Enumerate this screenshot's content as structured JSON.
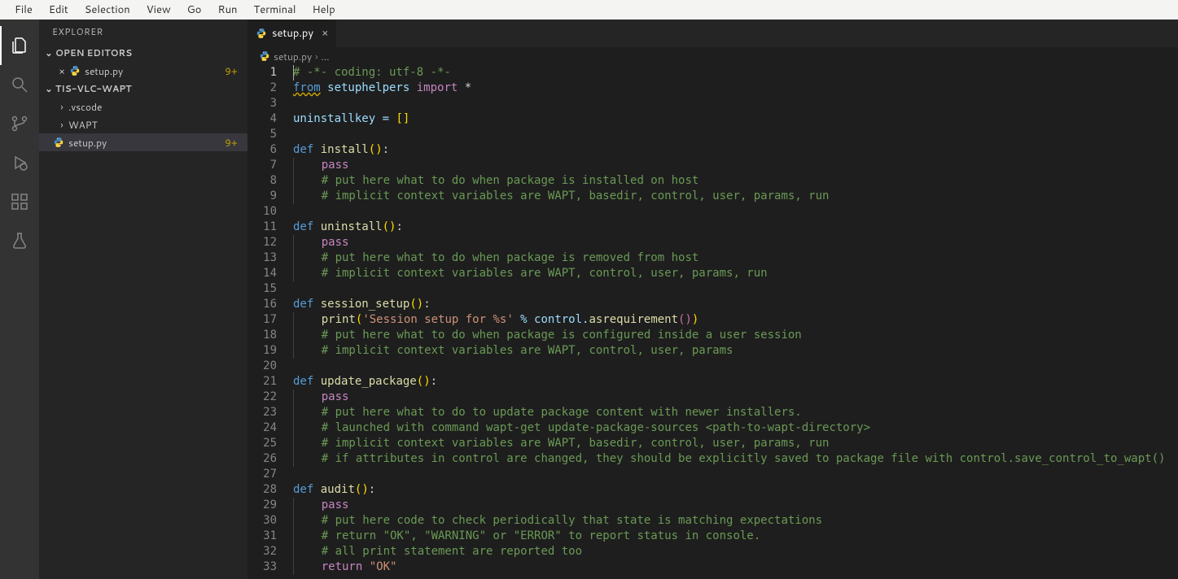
{
  "menubar": [
    "File",
    "Edit",
    "Selection",
    "View",
    "Go",
    "Run",
    "Terminal",
    "Help"
  ],
  "sidebar": {
    "title": "EXPLORER",
    "openEditorsHdr": "OPEN EDITORS",
    "openEditors": [
      {
        "name": "setup.py",
        "badge": "9+"
      }
    ],
    "projectHdr": "TIS-VLC-WAPT",
    "tree": [
      {
        "type": "folder",
        "name": ".vscode"
      },
      {
        "type": "folder",
        "name": "WAPT"
      },
      {
        "type": "file-py",
        "name": "setup.py",
        "badge": "9+"
      }
    ]
  },
  "tabs": [
    {
      "name": "setup.py",
      "lang": "python"
    }
  ],
  "breadcrumb": {
    "file": "setup.py",
    "more": "…"
  },
  "code": {
    "lines": [
      {
        "n": 1,
        "seg": [
          {
            "t": "# -*- coding: utf-8 -*-",
            "c": "comment"
          }
        ],
        "cursor": true
      },
      {
        "n": 2,
        "seg": [
          {
            "t": "from",
            "c": "defsquiggle"
          },
          {
            "t": " setuphelpers ",
            "c": "ident"
          },
          {
            "t": "import",
            "c": "keyword"
          },
          {
            "t": " *",
            "c": "punct"
          }
        ]
      },
      {
        "n": 3,
        "seg": []
      },
      {
        "n": 4,
        "seg": [
          {
            "t": "uninstallkey = ",
            "c": "ident"
          },
          {
            "t": "[",
            "c": "yellow"
          },
          {
            "t": "]",
            "c": "yellow"
          }
        ]
      },
      {
        "n": 5,
        "seg": []
      },
      {
        "n": 6,
        "seg": [
          {
            "t": "def",
            "c": "def"
          },
          {
            "t": " ",
            "c": "punct"
          },
          {
            "t": "install",
            "c": "funcname"
          },
          {
            "t": "(",
            "c": "yellow"
          },
          {
            "t": ")",
            "c": "yellow"
          },
          {
            "t": ":",
            "c": "punct"
          }
        ]
      },
      {
        "n": 7,
        "indent": 1,
        "seg": [
          {
            "t": "pass",
            "c": "keyword"
          }
        ]
      },
      {
        "n": 8,
        "indent": 1,
        "seg": [
          {
            "t": "# put here what to do when package is installed on host",
            "c": "comment"
          }
        ]
      },
      {
        "n": 9,
        "indent": 1,
        "seg": [
          {
            "t": "# implicit context variables are WAPT, basedir, control, user, params, run",
            "c": "comment"
          }
        ]
      },
      {
        "n": 10,
        "seg": []
      },
      {
        "n": 11,
        "seg": [
          {
            "t": "def",
            "c": "def"
          },
          {
            "t": " ",
            "c": "punct"
          },
          {
            "t": "uninstall",
            "c": "funcname"
          },
          {
            "t": "(",
            "c": "yellow"
          },
          {
            "t": ")",
            "c": "yellow"
          },
          {
            "t": ":",
            "c": "punct"
          }
        ]
      },
      {
        "n": 12,
        "indent": 1,
        "seg": [
          {
            "t": "pass",
            "c": "keyword"
          }
        ]
      },
      {
        "n": 13,
        "indent": 1,
        "seg": [
          {
            "t": "# put here what to do when package is removed from host",
            "c": "comment"
          }
        ]
      },
      {
        "n": 14,
        "indent": 1,
        "seg": [
          {
            "t": "# implicit context variables are WAPT, control, user, params, run",
            "c": "comment"
          }
        ]
      },
      {
        "n": 15,
        "seg": []
      },
      {
        "n": 16,
        "seg": [
          {
            "t": "def",
            "c": "def"
          },
          {
            "t": " ",
            "c": "punct"
          },
          {
            "t": "session_setup",
            "c": "funcname"
          },
          {
            "t": "(",
            "c": "yellow"
          },
          {
            "t": ")",
            "c": "yellow"
          },
          {
            "t": ":",
            "c": "punct"
          }
        ]
      },
      {
        "n": 17,
        "indent": 1,
        "seg": [
          {
            "t": "print",
            "c": "funcname"
          },
          {
            "t": "(",
            "c": "yellow"
          },
          {
            "t": "'Session setup for %s'",
            "c": "str"
          },
          {
            "t": " % control.",
            "c": "ident"
          },
          {
            "t": "asrequirement",
            "c": "funcname"
          },
          {
            "t": "(",
            "c": "pink"
          },
          {
            "t": ")",
            "c": "pink"
          },
          {
            "t": ")",
            "c": "yellow"
          }
        ]
      },
      {
        "n": 18,
        "indent": 1,
        "seg": [
          {
            "t": "# put here what to do when package is configured inside a user session",
            "c": "comment"
          }
        ]
      },
      {
        "n": 19,
        "indent": 1,
        "seg": [
          {
            "t": "# implicit context variables are WAPT, control, user, params",
            "c": "comment"
          }
        ]
      },
      {
        "n": 20,
        "seg": []
      },
      {
        "n": 21,
        "seg": [
          {
            "t": "def",
            "c": "def"
          },
          {
            "t": " ",
            "c": "punct"
          },
          {
            "t": "update_package",
            "c": "funcname"
          },
          {
            "t": "(",
            "c": "yellow"
          },
          {
            "t": ")",
            "c": "yellow"
          },
          {
            "t": ":",
            "c": "punct"
          }
        ]
      },
      {
        "n": 22,
        "indent": 1,
        "seg": [
          {
            "t": "pass",
            "c": "keyword"
          }
        ]
      },
      {
        "n": 23,
        "indent": 1,
        "seg": [
          {
            "t": "# put here what to do to update package content with newer installers.",
            "c": "comment"
          }
        ]
      },
      {
        "n": 24,
        "indent": 1,
        "seg": [
          {
            "t": "# launched with command wapt-get update-package-sources <path-to-wapt-directory>",
            "c": "comment"
          }
        ]
      },
      {
        "n": 25,
        "indent": 1,
        "seg": [
          {
            "t": "# implicit context variables are WAPT, basedir, control, user, params, run",
            "c": "comment"
          }
        ]
      },
      {
        "n": 26,
        "indent": 1,
        "seg": [
          {
            "t": "# if attributes in control are changed, they should be explicitly saved to package file with control.save_control_to_wapt()",
            "c": "comment"
          }
        ]
      },
      {
        "n": 27,
        "seg": []
      },
      {
        "n": 28,
        "seg": [
          {
            "t": "def",
            "c": "def"
          },
          {
            "t": " ",
            "c": "punct"
          },
          {
            "t": "audit",
            "c": "funcname"
          },
          {
            "t": "(",
            "c": "yellow"
          },
          {
            "t": ")",
            "c": "yellow"
          },
          {
            "t": ":",
            "c": "punct"
          }
        ]
      },
      {
        "n": 29,
        "indent": 1,
        "seg": [
          {
            "t": "pass",
            "c": "keyword"
          }
        ]
      },
      {
        "n": 30,
        "indent": 1,
        "seg": [
          {
            "t": "# put here code to check periodically that state is matching expectations",
            "c": "comment"
          }
        ]
      },
      {
        "n": 31,
        "indent": 1,
        "seg": [
          {
            "t": "# return \"OK\", \"WARNING\" or \"ERROR\" to report status in console.",
            "c": "comment"
          }
        ]
      },
      {
        "n": 32,
        "indent": 1,
        "seg": [
          {
            "t": "# all print statement are reported too",
            "c": "comment"
          }
        ]
      },
      {
        "n": 33,
        "indent": 1,
        "seg": [
          {
            "t": "return",
            "c": "keyword"
          },
          {
            "t": " ",
            "c": "punct"
          },
          {
            "t": "\"OK\"",
            "c": "str"
          }
        ]
      }
    ]
  }
}
